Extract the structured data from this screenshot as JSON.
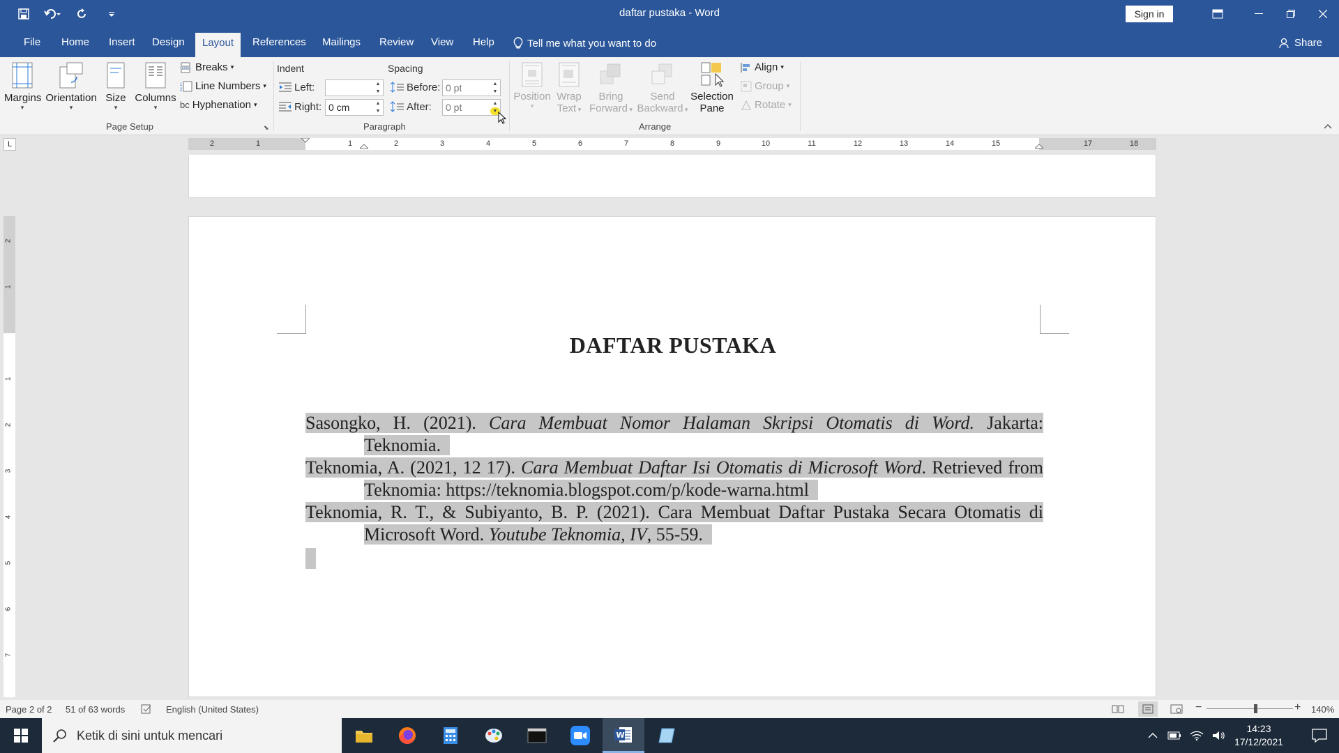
{
  "window": {
    "title": "daftar pustaka - Word",
    "signin_label": "Sign in"
  },
  "menu": {
    "tabs": [
      "File",
      "Home",
      "Insert",
      "Design",
      "Layout",
      "References",
      "Mailings",
      "Review",
      "View",
      "Help"
    ],
    "active_tab": "Layout",
    "tell_me": "Tell me what you want to do",
    "share": "Share"
  },
  "ribbon": {
    "page_setup": {
      "margins": "Margins",
      "orientation": "Orientation",
      "size": "Size",
      "columns": "Columns",
      "breaks": "Breaks",
      "line_numbers": "Line Numbers",
      "hyphenation": "Hyphenation",
      "group_label": "Page Setup"
    },
    "paragraph": {
      "indent_label": "Indent",
      "spacing_label": "Spacing",
      "left_label": "Left:",
      "left_value": "",
      "right_label": "Right:",
      "right_value": "0 cm",
      "before_label": "Before:",
      "before_value": "0 pt",
      "after_label": "After:",
      "after_value": "0 pt",
      "group_label": "Paragraph"
    },
    "arrange": {
      "position": "Position",
      "wrap_text_1": "Wrap",
      "wrap_text_2": "Text",
      "bring_forward_1": "Bring",
      "bring_forward_2": "Forward",
      "send_backward_1": "Send",
      "send_backward_2": "Backward",
      "selection_pane_1": "Selection",
      "selection_pane_2": "Pane",
      "align": "Align",
      "group": "Group",
      "rotate": "Rotate",
      "group_label": "Arrange"
    }
  },
  "ruler": {
    "corner": "L",
    "h_left": [
      "2",
      "1"
    ],
    "h_right": [
      "1",
      "2",
      "3",
      "4",
      "5",
      "6",
      "7",
      "8",
      "9",
      "10",
      "11",
      "12",
      "13",
      "14",
      "15",
      "17",
      "18"
    ],
    "v_top": [
      "2",
      "1"
    ],
    "v_main": [
      "1",
      "2",
      "3",
      "4",
      "5",
      "6",
      "7"
    ]
  },
  "document": {
    "heading": "DAFTAR PUSTAKA",
    "ref1_a": "Sasongko, H. (2021). ",
    "ref1_b": "Cara Membuat Nomor Halaman Skripsi Otomatis di Word.",
    "ref1_c": " Jakarta: Teknomia.",
    "ref2_a": "Teknomia, A. (2021, 12 17). ",
    "ref2_b": "Cara Membuat Daftar Isi Otomatis di Microsoft Word",
    "ref2_c": ". Retrieved from Teknomia: https://teknomia.blogspot.com/p/kode-warna.html",
    "ref3_a": "Teknomia, R. T., & Subiyanto, B. P. (2021). Cara Membuat Daftar Pustaka Secara Otomatis di Microsoft Word. ",
    "ref3_b": "Youtube Teknomia, IV",
    "ref3_c": ", 55-59."
  },
  "status": {
    "page": "Page 2 of 2",
    "words": "51 of 63 words",
    "language": "English (United States)",
    "zoom": "140%"
  },
  "taskbar": {
    "search_placeholder": "Ketik di sini untuk mencari",
    "time": "14:23",
    "date": "17/12/2021"
  },
  "colors": {
    "word_blue": "#2b579a",
    "selection": "#c6c6c6",
    "cursor_highlight": "#f5e12b"
  }
}
